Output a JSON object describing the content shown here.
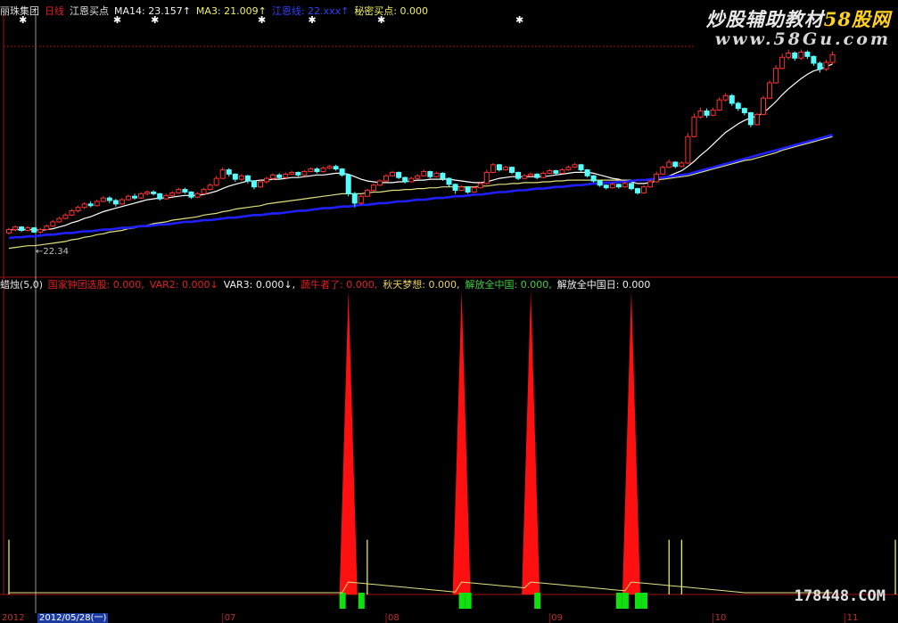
{
  "top_header": {
    "stock_name": "丽珠集团",
    "period": "日线",
    "indicator": "江恩买点",
    "ma14": "MA14: 23.157↑",
    "ma3": "MA3: 21.009↑",
    "blue_label": "江恩线: 22.xxx↑",
    "secret": "秘密买点: 0.000"
  },
  "bottom_header": {
    "name": "蜡烛",
    "params": "(5,0)",
    "items": [
      {
        "text": "国家钟团选股: 0.000,",
        "color": "#e02020"
      },
      {
        "text": "VAR2: 0.000↓",
        "color": "#e02020"
      },
      {
        "text": "VAR3: 0.000↓,",
        "color": "#f0f0f0"
      },
      {
        "text": "蔬牛者了: 0.000,",
        "color": "#e02020"
      },
      {
        "text": "秋天梦想: 0.000,",
        "color": "#e8d060"
      },
      {
        "text": "解放全中国: 0.000,",
        "color": "#40d040"
      },
      {
        "text": "解放全中国日: 0.000",
        "color": "#f0f0f0"
      }
    ]
  },
  "ma_label": "←22.34",
  "watermark": {
    "line1_main": "炒股辅助教材",
    "line1_accent": "58股网",
    "line2": "www.58Gu.com",
    "bottom": "178448.COM"
  },
  "date_axis": {
    "left_stub": "2012",
    "cursor": "2012/05/28(一)",
    "months": [
      "07",
      "08",
      "09",
      "10",
      "11"
    ]
  },
  "colors": {
    "up": "#ff3030",
    "down": "#54ffff",
    "ma_white": "#ffffff",
    "ma_yellow": "#e0e080",
    "ma_blue": "#2020ff",
    "spike": "#ff1010",
    "bar_green": "#10e010",
    "line_yellow": "#ffff40"
  },
  "chart_data": {
    "type": "candlestick",
    "candles": [
      [
        22.2,
        22.6,
        22.0,
        22.8
      ],
      [
        22.6,
        22.9,
        22.4,
        23.1
      ],
      [
        22.9,
        22.5,
        22.3,
        23.0
      ],
      [
        22.5,
        22.8,
        22.4,
        23.0
      ],
      [
        22.8,
        22.3,
        22.2,
        22.9
      ],
      [
        22.3,
        22.6,
        22.1,
        22.8
      ],
      [
        22.6,
        23.0,
        22.5,
        23.2
      ],
      [
        23.0,
        23.5,
        22.9,
        23.7
      ],
      [
        23.5,
        23.9,
        23.4,
        24.1
      ],
      [
        23.9,
        24.3,
        23.8,
        24.5
      ],
      [
        24.3,
        24.8,
        24.2,
        25.0
      ],
      [
        24.8,
        25.2,
        24.6,
        25.4
      ],
      [
        25.2,
        25.6,
        25.0,
        25.8
      ],
      [
        25.6,
        25.4,
        25.2,
        25.9
      ],
      [
        25.4,
        25.9,
        25.3,
        26.1
      ],
      [
        25.9,
        26.3,
        25.8,
        26.5
      ],
      [
        26.3,
        26.0,
        25.7,
        26.5
      ],
      [
        26.0,
        25.6,
        25.3,
        26.2
      ],
      [
        25.6,
        26.1,
        25.5,
        26.3
      ],
      [
        26.1,
        26.5,
        26.0,
        26.7
      ],
      [
        26.5,
        26.3,
        26.1,
        26.8
      ],
      [
        26.3,
        26.8,
        26.2,
        27.0
      ],
      [
        26.8,
        27.0,
        26.6,
        27.2
      ],
      [
        27.0,
        26.8,
        26.6,
        27.2
      ],
      [
        26.8,
        26.2,
        26.0,
        26.9
      ],
      [
        26.2,
        26.6,
        26.1,
        26.8
      ],
      [
        26.6,
        26.9,
        26.5,
        27.1
      ],
      [
        26.9,
        27.3,
        26.8,
        27.5
      ],
      [
        27.3,
        27.0,
        26.8,
        27.5
      ],
      [
        27.0,
        26.4,
        26.2,
        27.1
      ],
      [
        26.4,
        26.8,
        26.3,
        27.0
      ],
      [
        26.8,
        27.3,
        26.7,
        27.5
      ],
      [
        27.3,
        27.8,
        27.2,
        28.0
      ],
      [
        27.8,
        28.6,
        27.7,
        28.9
      ],
      [
        28.6,
        29.6,
        28.5,
        29.9
      ],
      [
        29.6,
        29.1,
        28.8,
        29.8
      ],
      [
        29.1,
        28.5,
        28.2,
        29.2
      ],
      [
        28.5,
        28.9,
        28.3,
        29.1
      ],
      [
        28.9,
        28.3,
        28.0,
        29.0
      ],
      [
        28.3,
        27.6,
        27.3,
        28.4
      ],
      [
        27.6,
        28.2,
        27.5,
        28.4
      ],
      [
        28.2,
        28.6,
        28.0,
        28.8
      ],
      [
        28.6,
        29.0,
        28.4,
        29.2
      ],
      [
        29.0,
        28.7,
        28.5,
        29.2
      ],
      [
        28.7,
        29.1,
        28.6,
        29.3
      ],
      [
        29.1,
        29.3,
        29.0,
        29.5
      ],
      [
        29.3,
        29.0,
        28.8,
        29.4
      ],
      [
        29.0,
        29.4,
        28.9,
        29.6
      ],
      [
        29.4,
        29.7,
        29.3,
        29.9
      ],
      [
        29.7,
        29.4,
        29.2,
        29.9
      ],
      [
        29.4,
        29.8,
        29.3,
        30.0
      ],
      [
        29.8,
        30.0,
        29.7,
        30.2
      ],
      [
        30.0,
        29.7,
        29.5,
        30.2
      ],
      [
        29.7,
        29.0,
        28.8,
        29.8
      ],
      [
        29.0,
        26.8,
        26.5,
        29.1
      ],
      [
        26.8,
        25.7,
        25.2,
        27.0
      ],
      [
        25.7,
        26.5,
        25.5,
        26.7
      ],
      [
        26.5,
        27.2,
        26.4,
        27.4
      ],
      [
        27.2,
        27.8,
        27.1,
        28.0
      ],
      [
        27.8,
        28.3,
        27.7,
        28.5
      ],
      [
        28.3,
        28.9,
        28.2,
        29.1
      ],
      [
        28.9,
        29.3,
        28.8,
        29.5
      ],
      [
        29.3,
        28.7,
        28.5,
        29.4
      ],
      [
        28.7,
        28.2,
        28.0,
        28.8
      ],
      [
        28.2,
        28.6,
        28.1,
        28.8
      ],
      [
        28.6,
        28.9,
        28.5,
        29.1
      ],
      [
        28.9,
        29.4,
        28.8,
        29.6
      ],
      [
        29.4,
        28.8,
        28.6,
        29.5
      ],
      [
        28.8,
        29.2,
        28.7,
        29.4
      ],
      [
        29.2,
        28.6,
        28.3,
        29.3
      ],
      [
        28.6,
        27.9,
        27.6,
        28.7
      ],
      [
        27.9,
        27.2,
        26.8,
        28.0
      ],
      [
        27.2,
        27.6,
        27.1,
        27.8
      ],
      [
        27.6,
        27.0,
        26.8,
        27.7
      ],
      [
        27.0,
        27.5,
        26.9,
        27.7
      ],
      [
        27.5,
        28.0,
        27.4,
        28.2
      ],
      [
        28.0,
        29.3,
        27.9,
        29.6
      ],
      [
        29.3,
        30.2,
        29.2,
        30.4
      ],
      [
        30.2,
        29.6,
        29.4,
        30.3
      ],
      [
        29.6,
        29.9,
        29.5,
        30.1
      ],
      [
        29.9,
        29.3,
        29.1,
        30.0
      ],
      [
        29.3,
        28.6,
        28.4,
        29.4
      ],
      [
        28.6,
        28.9,
        28.5,
        29.1
      ],
      [
        28.9,
        29.1,
        28.8,
        29.3
      ],
      [
        29.1,
        28.7,
        28.5,
        29.2
      ],
      [
        28.7,
        29.2,
        28.6,
        29.4
      ],
      [
        29.2,
        29.5,
        29.1,
        29.7
      ],
      [
        29.5,
        29.2,
        29.0,
        29.6
      ],
      [
        29.2,
        29.6,
        29.1,
        29.8
      ],
      [
        29.6,
        29.9,
        29.5,
        30.1
      ],
      [
        29.9,
        30.2,
        29.8,
        30.4
      ],
      [
        30.2,
        29.6,
        29.4,
        30.3
      ],
      [
        29.6,
        28.9,
        28.7,
        29.7
      ],
      [
        28.9,
        28.3,
        28.1,
        29.0
      ],
      [
        28.3,
        27.8,
        27.6,
        28.4
      ],
      [
        27.8,
        27.5,
        27.3,
        27.9
      ],
      [
        27.5,
        27.9,
        27.4,
        28.1
      ],
      [
        27.9,
        27.6,
        27.4,
        28.0
      ],
      [
        27.6,
        28.0,
        27.5,
        28.2
      ],
      [
        28.0,
        27.4,
        27.2,
        28.1
      ],
      [
        27.4,
        26.9,
        26.7,
        27.5
      ],
      [
        26.9,
        27.6,
        26.8,
        27.8
      ],
      [
        27.6,
        28.2,
        27.5,
        28.4
      ],
      [
        28.2,
        29.1,
        28.1,
        29.4
      ],
      [
        29.1,
        29.9,
        29.0,
        30.1
      ],
      [
        29.9,
        30.5,
        29.8,
        30.8
      ],
      [
        30.5,
        30.0,
        29.8,
        30.6
      ],
      [
        30.0,
        30.4,
        29.9,
        30.6
      ],
      [
        30.4,
        33.5,
        30.3,
        33.9
      ],
      [
        33.5,
        35.8,
        33.4,
        36.2
      ],
      [
        35.8,
        36.5,
        35.6,
        36.9
      ],
      [
        36.5,
        36.0,
        35.7,
        36.8
      ],
      [
        36.0,
        36.6,
        35.9,
        36.9
      ],
      [
        36.6,
        37.8,
        36.5,
        38.1
      ],
      [
        37.8,
        38.3,
        37.6,
        38.6
      ],
      [
        38.3,
        37.4,
        37.1,
        38.5
      ],
      [
        37.4,
        36.8,
        36.5,
        37.6
      ],
      [
        36.8,
        36.3,
        36.0,
        36.9
      ],
      [
        36.3,
        34.9,
        34.6,
        36.4
      ],
      [
        34.9,
        36.1,
        34.8,
        36.3
      ],
      [
        36.1,
        38.0,
        36.0,
        38.3
      ],
      [
        38.0,
        39.8,
        37.9,
        40.1
      ],
      [
        39.8,
        41.5,
        39.7,
        41.9
      ],
      [
        41.5,
        42.8,
        41.4,
        43.2
      ],
      [
        42.8,
        43.3,
        42.5,
        43.7
      ],
      [
        43.3,
        42.7,
        42.4,
        43.5
      ],
      [
        42.7,
        43.4,
        42.5,
        43.7
      ],
      [
        43.4,
        42.9,
        42.6,
        43.6
      ],
      [
        42.9,
        42.1,
        41.8,
        43.0
      ],
      [
        42.1,
        41.4,
        41.0,
        42.3
      ],
      [
        41.4,
        42.2,
        41.2,
        42.5
      ],
      [
        42.2,
        43.1,
        42.0,
        43.5
      ]
    ],
    "ma_white": [
      22.6,
      22.6,
      22.6,
      22.6,
      22.6,
      22.5,
      22.6,
      22.7,
      22.9,
      23.1,
      23.4,
      23.6,
      23.9,
      24.1,
      24.4,
      24.7,
      24.9,
      25.1,
      25.3,
      25.5,
      25.7,
      25.9,
      26.1,
      26.2,
      26.3,
      26.3,
      26.4,
      26.5,
      26.6,
      26.6,
      26.6,
      26.7,
      26.9,
      27.1,
      27.4,
      27.7,
      27.9,
      28.1,
      28.3,
      28.3,
      28.4,
      28.4,
      28.5,
      28.5,
      28.6,
      28.7,
      28.7,
      28.8,
      28.9,
      29.0,
      29.0,
      29.1,
      29.2,
      29.2,
      29.1,
      28.8,
      28.5,
      28.3,
      28.2,
      28.1,
      28.1,
      28.1,
      28.2,
      28.2,
      28.3,
      28.4,
      28.4,
      28.5,
      28.5,
      28.5,
      28.5,
      28.4,
      28.3,
      28.2,
      28.1,
      28.1,
      28.2,
      28.4,
      28.6,
      28.7,
      28.8,
      28.8,
      28.8,
      28.8,
      28.8,
      28.8,
      28.9,
      29.0,
      29.1,
      29.2,
      29.3,
      29.3,
      29.3,
      29.2,
      29.0,
      28.8,
      28.6,
      28.5,
      28.3,
      28.2,
      28.0,
      28.0,
      28.1,
      28.3,
      28.6,
      28.9,
      29.2,
      29.5,
      30.0,
      30.6,
      31.3,
      31.9,
      32.6,
      33.3,
      34.0,
      34.5,
      35.0,
      35.4,
      35.7,
      35.9,
      36.3,
      36.9,
      37.6,
      38.4,
      39.1,
      39.7,
      40.3,
      40.8,
      41.2,
      41.4,
      41.7,
      42.0
    ],
    "ma_yellow": [
      20.4,
      20.5,
      20.6,
      20.7,
      20.7,
      20.8,
      20.9,
      21.0,
      21.1,
      21.2,
      21.4,
      21.5,
      21.7,
      21.8,
      22.0,
      22.1,
      22.3,
      22.4,
      22.5,
      22.7,
      22.8,
      23.0,
      23.1,
      23.3,
      23.4,
      23.5,
      23.7,
      23.8,
      23.9,
      24.0,
      24.1,
      24.3,
      24.4,
      24.5,
      24.7,
      24.8,
      25.0,
      25.1,
      25.2,
      25.3,
      25.4,
      25.6,
      25.7,
      25.8,
      25.9,
      26.0,
      26.1,
      26.2,
      26.3,
      26.4,
      26.5,
      26.6,
      26.7,
      26.8,
      26.8,
      26.8,
      26.8,
      26.9,
      27.0,
      27.0,
      27.1,
      27.2,
      27.2,
      27.3,
      27.3,
      27.4,
      27.4,
      27.5,
      27.5,
      27.6,
      27.6,
      27.6,
      27.6,
      27.6,
      27.6,
      27.7,
      27.7,
      27.8,
      27.9,
      27.9,
      28.0,
      28.0,
      28.1,
      28.1,
      28.1,
      28.2,
      28.2,
      28.3,
      28.3,
      28.4,
      28.4,
      28.4,
      28.4,
      28.4,
      28.4,
      28.4,
      28.4,
      28.4,
      28.4,
      28.4,
      28.4,
      28.4,
      28.4,
      28.5,
      28.5,
      28.6,
      28.7,
      28.8,
      28.9,
      29.1,
      29.3,
      29.5,
      29.7,
      29.9,
      30.1,
      30.3,
      30.5,
      30.7,
      30.8,
      31.0,
      31.2,
      31.4,
      31.6,
      31.9,
      32.1,
      32.3,
      32.5,
      32.7,
      32.9,
      33.1,
      33.3,
      33.5
    ],
    "ma_blue": [
      21.6,
      21.7,
      21.7,
      21.8,
      21.8,
      21.9,
      22.0,
      22.0,
      22.1,
      22.2,
      22.2,
      22.3,
      22.4,
      22.4,
      22.5,
      22.6,
      22.6,
      22.7,
      22.8,
      22.8,
      22.9,
      23.0,
      23.0,
      23.1,
      23.2,
      23.2,
      23.3,
      23.4,
      23.5,
      23.5,
      23.6,
      23.7,
      23.7,
      23.8,
      23.9,
      24.0,
      24.0,
      24.1,
      24.2,
      24.3,
      24.3,
      24.4,
      24.5,
      24.5,
      24.6,
      24.7,
      24.8,
      24.8,
      24.9,
      25.0,
      25.1,
      25.1,
      25.2,
      25.3,
      25.3,
      25.4,
      25.5,
      25.5,
      25.6,
      25.7,
      25.7,
      25.8,
      25.9,
      25.9,
      26.0,
      26.1,
      26.1,
      26.2,
      26.3,
      26.3,
      26.4,
      26.5,
      26.5,
      26.6,
      26.7,
      26.7,
      26.8,
      26.9,
      27.0,
      27.0,
      27.1,
      27.2,
      27.2,
      27.3,
      27.4,
      27.4,
      27.5,
      27.6,
      27.6,
      27.7,
      27.8,
      27.8,
      27.9,
      28.0,
      28.0,
      28.1,
      28.1,
      28.2,
      28.2,
      28.3,
      28.4,
      28.4,
      28.5,
      28.6,
      28.7,
      28.8,
      28.9,
      29.0,
      29.1,
      29.3,
      29.5,
      29.7,
      29.9,
      30.1,
      30.3,
      30.5,
      30.7,
      30.9,
      31.1,
      31.3,
      31.5,
      31.7,
      31.9,
      32.1,
      32.3,
      32.5,
      32.7,
      32.9,
      33.1,
      33.3,
      33.5,
      33.7
    ],
    "y_range": [
      19.0,
      44.5
    ],
    "markers": [
      2,
      17,
      23,
      40,
      48,
      59,
      81
    ],
    "spikes": [
      {
        "index": 54,
        "value": 100
      },
      {
        "index": 72,
        "value": 100
      },
      {
        "index": 83,
        "value": 100
      },
      {
        "index": 99,
        "value": 100
      }
    ],
    "green_bars": [
      53,
      56,
      72,
      73,
      84,
      97,
      98,
      100,
      101
    ],
    "yellow_lines": [
      {
        "index": 57,
        "value": 18
      },
      {
        "index": 105,
        "value": 18
      },
      {
        "index": 107,
        "value": 18
      },
      {
        "index": 0,
        "value": 18
      },
      {
        "index": 141,
        "value": 18
      }
    ],
    "month_ticks": [
      34,
      60,
      86,
      112,
      133
    ]
  }
}
